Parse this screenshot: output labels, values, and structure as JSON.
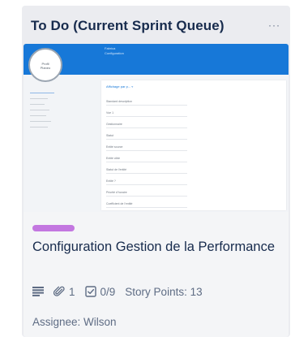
{
  "list": {
    "title": "To Do (Current Sprint Queue)",
    "menu_glyph": "···"
  },
  "card": {
    "cover": {
      "topbar_lines": [
        "Fabrica",
        "Configuration"
      ],
      "circle_lines": [
        "Profil",
        "Planeo"
      ],
      "tabs_label": "Affichage par p... ▿",
      "fields": [
        "Standard description",
        "Vue 1",
        "Gestionnaire",
        "Statut",
        "Entité source",
        "Entité cible",
        "Statut de l’entité",
        "Entité ?",
        "Priorité d’horaire",
        "Coefficient de l’entité"
      ]
    },
    "label_color": "#c377e0",
    "title": "Configuration Gestion de la Performance",
    "badges": {
      "description_icon": "description-icon",
      "attachment_icon": "paperclip-icon",
      "attachment_count": "1",
      "checklist_icon": "checklist-icon",
      "checklist_progress": "0/9",
      "story_points": "Story Points: 13"
    },
    "assignee": "Assignee: Wilson"
  }
}
